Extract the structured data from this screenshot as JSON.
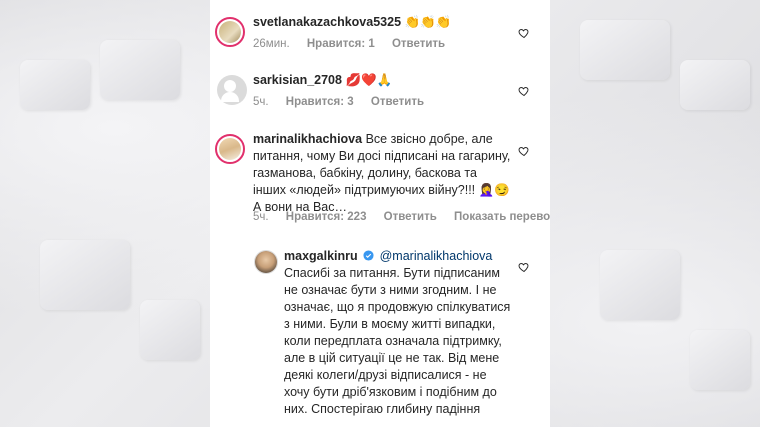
{
  "comments": [
    {
      "username": "svetlanakazachkova5325",
      "text": "👏👏👏",
      "time": "26мин.",
      "likes": "Нравится: 1",
      "reply": "Ответить"
    },
    {
      "username": "sarkisian_2708",
      "text": "💋❤️🙏",
      "time": "5ч.",
      "likes": "Нравится: 3",
      "reply": "Ответить"
    },
    {
      "username": "marinalikhachiova",
      "text": "Все звісно добре, але питання, чому Ви досі підписані на гагарину, газманова, бабкіну, долину, баскова та інших «людей» підтримуючих війну?!!! 🤦‍♀️😏 А вони на Вас…",
      "time": "5ч.",
      "likes": "Нравится: 223",
      "reply": "Ответить",
      "translate": "Показать перевод"
    },
    {
      "username": "maxgalkinru",
      "mention": "@marinalikhachiova",
      "text": "Спасибі за питання.  Бути підписаним не означає бути з ними згодним.  І не означає, що я продовжую спілкуватися з ними. Були в моєму житті випадки, коли передплата означала підтримку, але в цій ситуації це не так.  Від мене деякі колеги/друзі відписалися - не хочу бути дріб'язковим і подібним до них. Спостерігаю глибину падіння"
    }
  ],
  "colors": {
    "accent_ring": "#e1306c",
    "verified": "#3897f0",
    "mention": "#00376b",
    "meta": "#8e8e8e"
  },
  "icons": {
    "like": "heart-outline-icon",
    "verified": "verified-badge-icon"
  }
}
